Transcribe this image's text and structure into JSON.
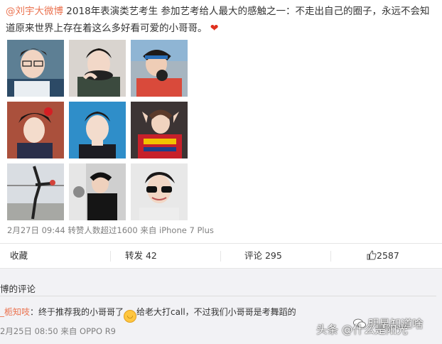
{
  "post": {
    "author": "@刘宇大微博",
    "body": "2018年表演类艺考生 参加艺考给人最大的感触之一：不走出自己的圈子，永远不会知道原来世界上存在着这么多好看可爱的小哥哥。",
    "heart_icon": "heart-icon"
  },
  "images": [
    {
      "alt": "photo-1"
    },
    {
      "alt": "photo-2"
    },
    {
      "alt": "photo-3"
    },
    {
      "alt": "photo-4"
    },
    {
      "alt": "photo-5"
    },
    {
      "alt": "photo-6"
    },
    {
      "alt": "photo-7"
    },
    {
      "alt": "photo-8"
    },
    {
      "alt": "photo-9"
    }
  ],
  "meta": {
    "time": "2月27日 09:44",
    "reposts_over": "转赞人数超过1600",
    "source": "来自 iPhone 7 Plus"
  },
  "actions": {
    "favorite": "收藏",
    "repost": "转发 42",
    "comment": "评论 295",
    "like": "2587"
  },
  "comments": {
    "title": "博的评论",
    "items": [
      {
        "user": "_栀知吱",
        "text_before": "：终于推荐我的小哥哥了",
        "emoji": "😂",
        "text_after": "给老大打call，不过我们小哥哥是考舞蹈的",
        "time": "2月25日 08:50",
        "source": "来自 OPPO R9"
      }
    ]
  },
  "watermarks": {
    "left": "头条 @什么是阳光",
    "right": "明星知道啥"
  },
  "colors": {
    "link": "#eb7350",
    "meta": "#808080",
    "comment_bg": "#f2f2f5"
  }
}
